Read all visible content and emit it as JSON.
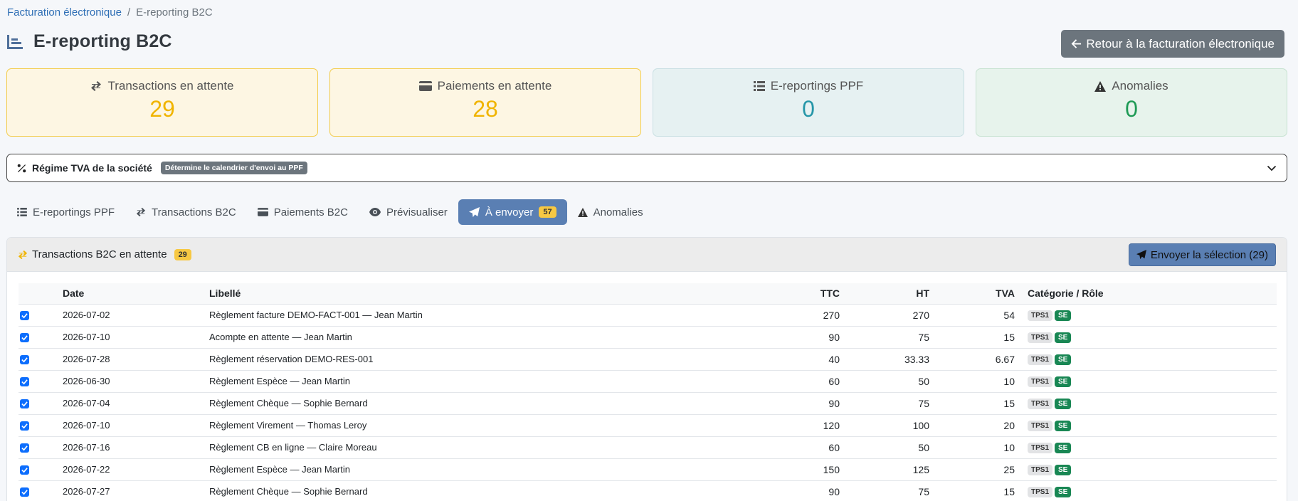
{
  "breadcrumb": {
    "parent": "Facturation électronique",
    "current": "E-reporting B2C"
  },
  "page": {
    "title": "E-reporting B2C",
    "back_label": "Retour à la facturation électronique"
  },
  "cards": [
    {
      "label": "Transactions en attente",
      "value": "29",
      "icon": "exchange-icon"
    },
    {
      "label": "Paiements en attente",
      "value": "28",
      "icon": "credit-card-icon"
    },
    {
      "label": "E-reportings PPF",
      "value": "0",
      "icon": "list-icon"
    },
    {
      "label": "Anomalies",
      "value": "0",
      "icon": "warning-icon"
    }
  ],
  "regime": {
    "label": "Régime TVA de la société",
    "badge": "Détermine le calendrier d'envoi au PPF"
  },
  "tabs": [
    {
      "label": "E-reportings PPF"
    },
    {
      "label": "Transactions B2C"
    },
    {
      "label": "Paiements B2C"
    },
    {
      "label": "Prévisualiser"
    },
    {
      "label": "À envoyer",
      "badge": "57",
      "active": true
    },
    {
      "label": "Anomalies"
    }
  ],
  "panel": {
    "title": "Transactions B2C en attente",
    "badge": "29",
    "send_label": "Envoyer la sélection (29)"
  },
  "table": {
    "headers": {
      "date": "Date",
      "libelle": "Libellé",
      "ttc": "TTC",
      "ht": "HT",
      "tva": "TVA",
      "cat": "Catégorie / Rôle"
    },
    "rows": [
      {
        "date": "2026-07-02",
        "libelle": "Règlement facture DEMO-FACT-001 — Jean Martin",
        "ttc": "270",
        "ht": "270",
        "tva": "54",
        "cat": "TPS1",
        "role": "SE"
      },
      {
        "date": "2026-07-10",
        "libelle": "Acompte en attente — Jean Martin",
        "ttc": "90",
        "ht": "75",
        "tva": "15",
        "cat": "TPS1",
        "role": "SE"
      },
      {
        "date": "2026-07-28",
        "libelle": "Règlement réservation DEMO-RES-001",
        "ttc": "40",
        "ht": "33.33",
        "tva": "6.67",
        "cat": "TPS1",
        "role": "SE"
      },
      {
        "date": "2026-06-30",
        "libelle": "Règlement Espèce — Jean Martin",
        "ttc": "60",
        "ht": "50",
        "tva": "10",
        "cat": "TPS1",
        "role": "SE"
      },
      {
        "date": "2026-07-04",
        "libelle": "Règlement Chèque — Sophie Bernard",
        "ttc": "90",
        "ht": "75",
        "tva": "15",
        "cat": "TPS1",
        "role": "SE"
      },
      {
        "date": "2026-07-10",
        "libelle": "Règlement Virement — Thomas Leroy",
        "ttc": "120",
        "ht": "100",
        "tva": "20",
        "cat": "TPS1",
        "role": "SE"
      },
      {
        "date": "2026-07-16",
        "libelle": "Règlement CB en ligne — Claire Moreau",
        "ttc": "60",
        "ht": "50",
        "tva": "10",
        "cat": "TPS1",
        "role": "SE"
      },
      {
        "date": "2026-07-22",
        "libelle": "Règlement Espèce — Jean Martin",
        "ttc": "150",
        "ht": "125",
        "tva": "25",
        "cat": "TPS1",
        "role": "SE"
      },
      {
        "date": "2026-07-27",
        "libelle": "Règlement Chèque — Sophie Bernard",
        "ttc": "90",
        "ht": "75",
        "tva": "15",
        "cat": "TPS1",
        "role": "SE"
      }
    ]
  },
  "colors": {
    "primary": "#5a7fb3",
    "warning": "#f0b400",
    "info": "#2596a8",
    "success": "#1e9a55"
  }
}
